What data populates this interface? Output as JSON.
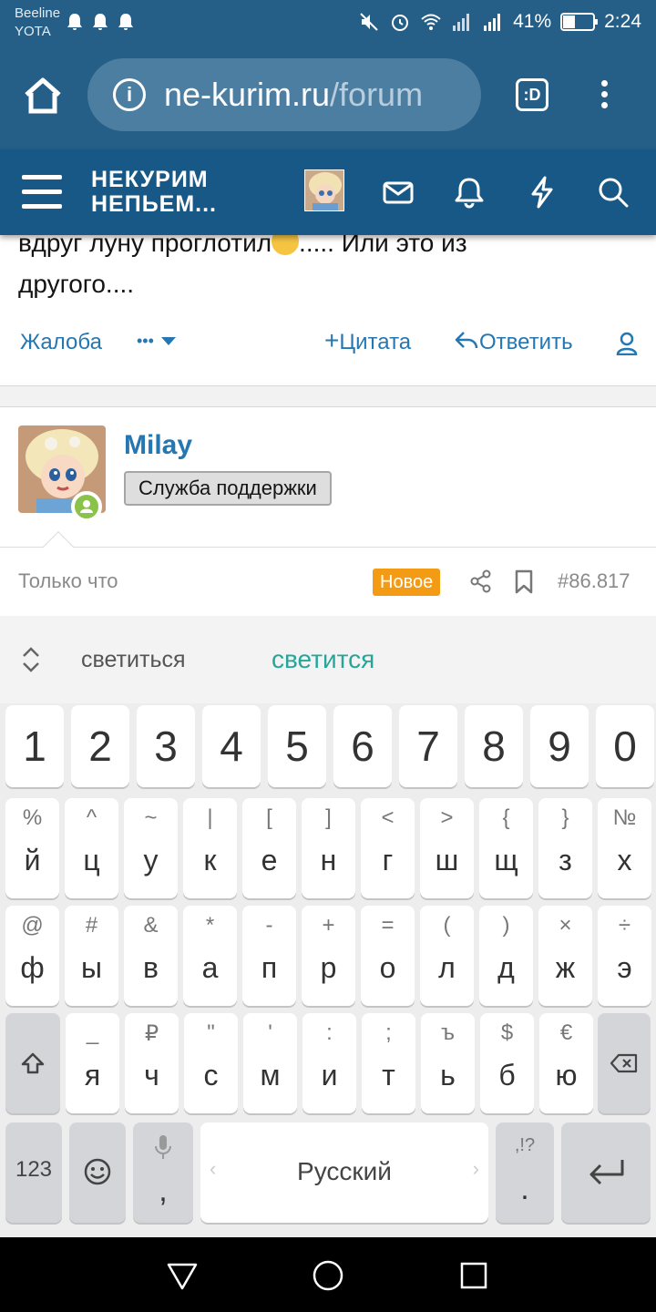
{
  "status_bar": {
    "carrier1": "Beeline",
    "carrier2": "YOTA",
    "battery_text": "41%",
    "battery_level": 0.41,
    "time": "2:24"
  },
  "browser": {
    "url_host": "ne-kurim.ru",
    "url_path": "/forum",
    "tabs_label": ":D"
  },
  "site_header": {
    "logo_line1": "НЕКУРИМ",
    "logo_line2": "НЕПЬЕМ..."
  },
  "post": {
    "text_line1_before_emoji": "вдруг луну проглотил",
    "text_line1_after_emoji": "..... Или это из",
    "text_line2": "другого....",
    "actions": {
      "report": "Жалоба",
      "more": "•••",
      "quote": "Цитата",
      "reply": "Ответить"
    }
  },
  "next_post": {
    "username": "Milay",
    "user_title": "Служба поддержки",
    "time": "Только что",
    "new_badge": "Новое",
    "post_number": "#86.817"
  },
  "keyboard": {
    "suggestions": [
      "светиться",
      "светится"
    ],
    "number_row": [
      "1",
      "2",
      "3",
      "4",
      "5",
      "6",
      "7",
      "8",
      "9",
      "0"
    ],
    "row1": [
      {
        "main": "й",
        "sub": "%"
      },
      {
        "main": "ц",
        "sub": "^"
      },
      {
        "main": "у",
        "sub": "~"
      },
      {
        "main": "к",
        "sub": "|"
      },
      {
        "main": "е",
        "sub": "["
      },
      {
        "main": "н",
        "sub": "]"
      },
      {
        "main": "г",
        "sub": "<"
      },
      {
        "main": "ш",
        "sub": ">"
      },
      {
        "main": "щ",
        "sub": "{"
      },
      {
        "main": "з",
        "sub": "}"
      },
      {
        "main": "х",
        "sub": "№"
      }
    ],
    "row2": [
      {
        "main": "ф",
        "sub": "@"
      },
      {
        "main": "ы",
        "sub": "#"
      },
      {
        "main": "в",
        "sub": "&"
      },
      {
        "main": "а",
        "sub": "*"
      },
      {
        "main": "п",
        "sub": "-"
      },
      {
        "main": "р",
        "sub": "+"
      },
      {
        "main": "о",
        "sub": "="
      },
      {
        "main": "л",
        "sub": "("
      },
      {
        "main": "д",
        "sub": ")"
      },
      {
        "main": "ж",
        "sub": "×"
      },
      {
        "main": "э",
        "sub": "÷"
      }
    ],
    "row3": [
      {
        "main": "я",
        "sub": "_"
      },
      {
        "main": "ч",
        "sub": "₽"
      },
      {
        "main": "с",
        "sub": "\""
      },
      {
        "main": "м",
        "sub": "'"
      },
      {
        "main": "и",
        "sub": ":"
      },
      {
        "main": "т",
        "sub": ";"
      },
      {
        "main": "ь",
        "sub": "ъ"
      },
      {
        "main": "б",
        "sub": "$"
      },
      {
        "main": "ю",
        "sub": "€"
      }
    ],
    "symbols_key": "123",
    "comma_key": ",",
    "space_label": "Русский",
    "period_key": ".",
    "period_sub": ",!?"
  },
  "colors": {
    "browser_bar": "#255f87",
    "site_header": "#185886",
    "link": "#2577b1",
    "new_badge": "#f49b16",
    "suggestion_accent": "#26a69a",
    "online": "#8bc34a"
  },
  "icons": {
    "status": [
      "bell-icon",
      "mute-icon",
      "alarm-icon",
      "wifi-icon",
      "signal-icon",
      "battery-icon"
    ],
    "browser": [
      "home-icon",
      "info-icon",
      "tabs-icon",
      "more-vert-icon"
    ],
    "header": [
      "menu-icon",
      "mail-icon",
      "bell-icon",
      "bolt-icon",
      "search-icon"
    ]
  }
}
